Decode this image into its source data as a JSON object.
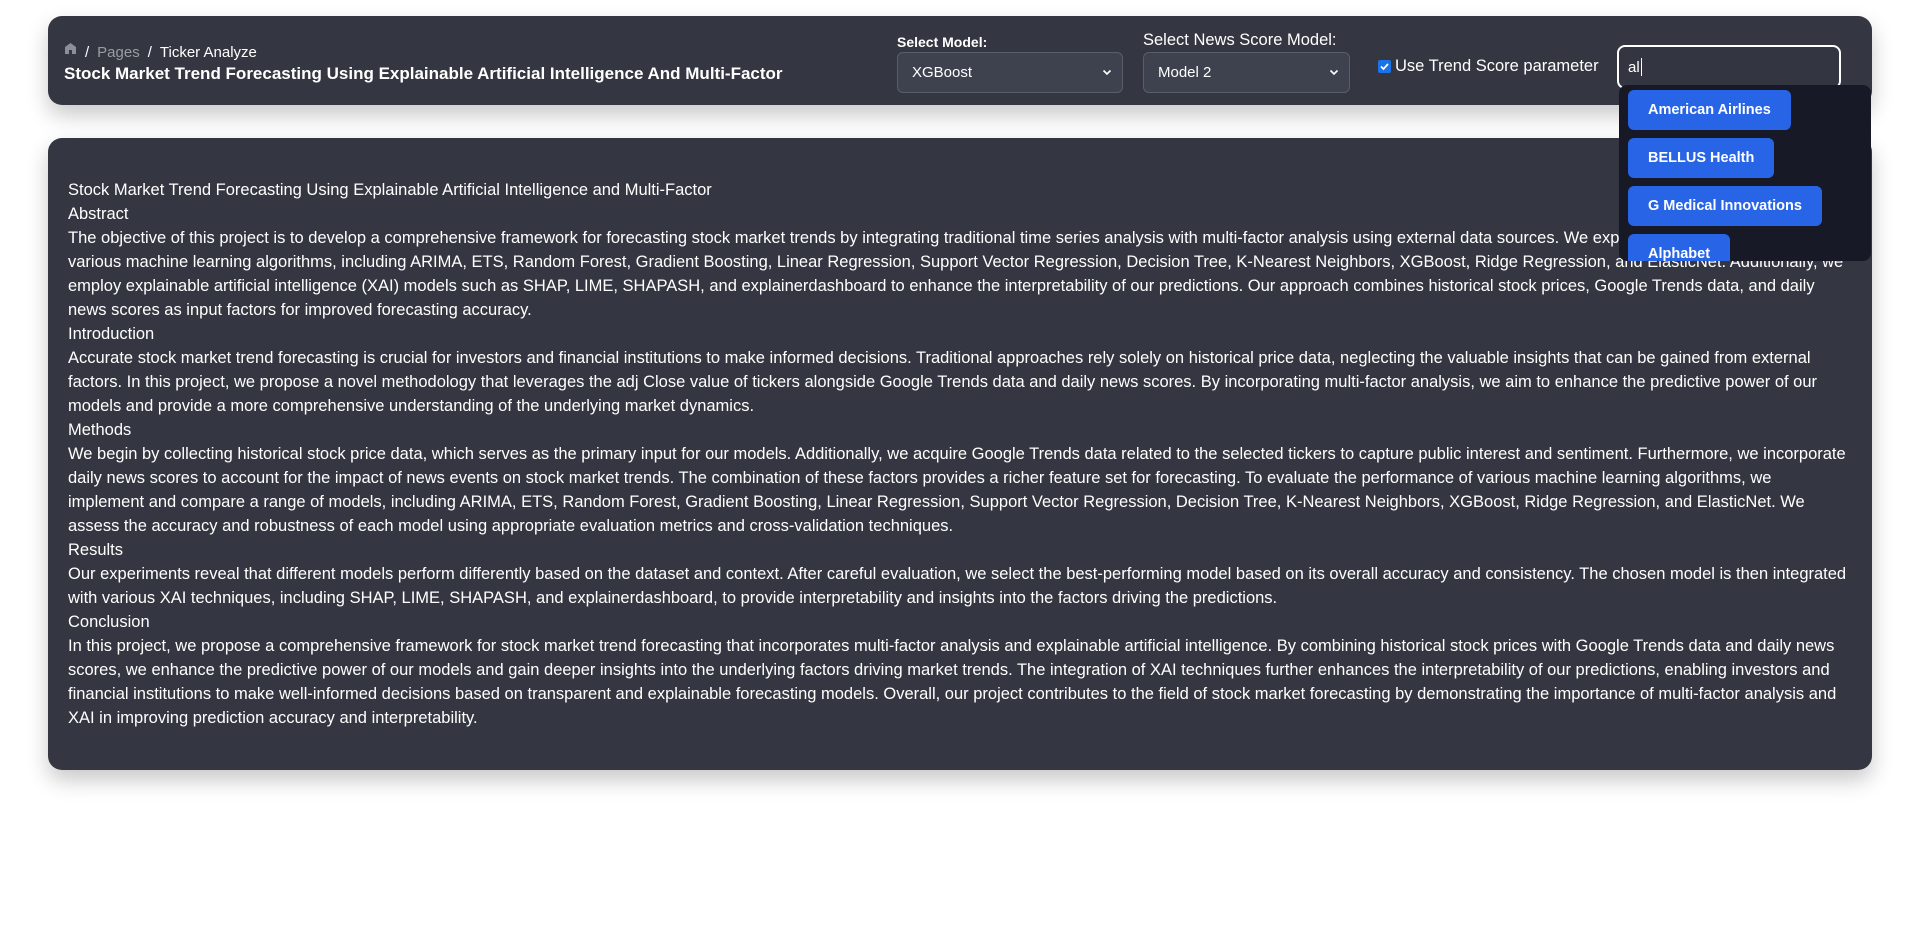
{
  "breadcrumb": {
    "items": [
      "Pages",
      "Ticker Analyze"
    ],
    "separator": "/"
  },
  "page_title": "Stock Market Trend Forecasting Using Explainable Artificial Intelligence And Multi-Factor",
  "model_select": {
    "label": "Select Model:",
    "value": "XGBoost"
  },
  "news_model_select": {
    "label": "Select News Score Model:",
    "value": "Model 2"
  },
  "trend_checkbox": {
    "label": "Use Trend Score parameter",
    "checked": true
  },
  "ticker_search": {
    "value": "al"
  },
  "dropdown": {
    "items": [
      "American Airlines",
      "BELLUS Health",
      "G Medical Innovations",
      "Alphabet"
    ]
  },
  "article": {
    "title": "Stock Market Trend Forecasting Using Explainable Artificial Intelligence and Multi-Factor",
    "abstract_heading": "Abstract",
    "abstract_text": "The objective of this project is to develop a comprehensive framework for forecasting stock market trends by integrating traditional time series analysis with multi-factor analysis using external data sources. We explore the predictive power of various machine learning algorithms, including ARIMA, ETS, Random Forest, Gradient Boosting, Linear Regression, Support Vector Regression, Decision Tree, K-Nearest Neighbors, XGBoost, Ridge Regression, and ElasticNet. Additionally, we employ explainable artificial intelligence (XAI) models such as SHAP, LIME, SHAPASH, and explainerdashboard to enhance the interpretability of our predictions. Our approach combines historical stock prices, Google Trends data, and daily news scores as input factors for improved forecasting accuracy.",
    "introduction_heading": "Introduction",
    "introduction_text": "Accurate stock market trend forecasting is crucial for investors and financial institutions to make informed decisions. Traditional approaches rely solely on historical price data, neglecting the valuable insights that can be gained from external factors. In this project, we propose a novel methodology that leverages the adj Close value of tickers alongside Google Trends data and daily news scores. By incorporating multi-factor analysis, we aim to enhance the predictive power of our models and provide a more comprehensive understanding of the underlying market dynamics.",
    "methods_heading": "Methods",
    "methods_text": "We begin by collecting historical stock price data, which serves as the primary input for our models. Additionally, we acquire Google Trends data related to the selected tickers to capture public interest and sentiment. Furthermore, we incorporate daily news scores to account for the impact of news events on stock market trends. The combination of these factors provides a richer feature set for forecasting. To evaluate the performance of various machine learning algorithms, we implement and compare a range of models, including ARIMA, ETS, Random Forest, Gradient Boosting, Linear Regression, Support Vector Regression, Decision Tree, K-Nearest Neighbors, XGBoost, Ridge Regression, and ElasticNet. We assess the accuracy and robustness of each model using appropriate evaluation metrics and cross-validation techniques.",
    "results_heading": "Results",
    "results_text": "Our experiments reveal that different models perform differently based on the dataset and context. After careful evaluation, we select the best-performing model based on its overall accuracy and consistency. The chosen model is then integrated with various XAI techniques, including SHAP, LIME, SHAPASH, and explainerdashboard, to provide interpretability and insights into the factors driving the predictions.",
    "conclusion_heading": "Conclusion",
    "conclusion_text": "In this project, we propose a comprehensive framework for stock market trend forecasting that incorporates multi-factor analysis and explainable artificial intelligence. By combining historical stock prices with Google Trends data and daily news scores, we enhance the predictive power of our models and gain deeper insights into the underlying factors driving market trends. The integration of XAI techniques further enhances the interpretability of our predictions, enabling investors and financial institutions to make well-informed decisions based on transparent and explainable forecasting models. Overall, our project contributes to the field of stock market forecasting by demonstrating the importance of multi-factor analysis and XAI in improving prediction accuracy and interpretability."
  },
  "colors": {
    "panel_bg": "#343741",
    "dropdown_bg": "#171a26",
    "dropdown_item": "#2764e6",
    "checkbox": "#1a73e8"
  }
}
